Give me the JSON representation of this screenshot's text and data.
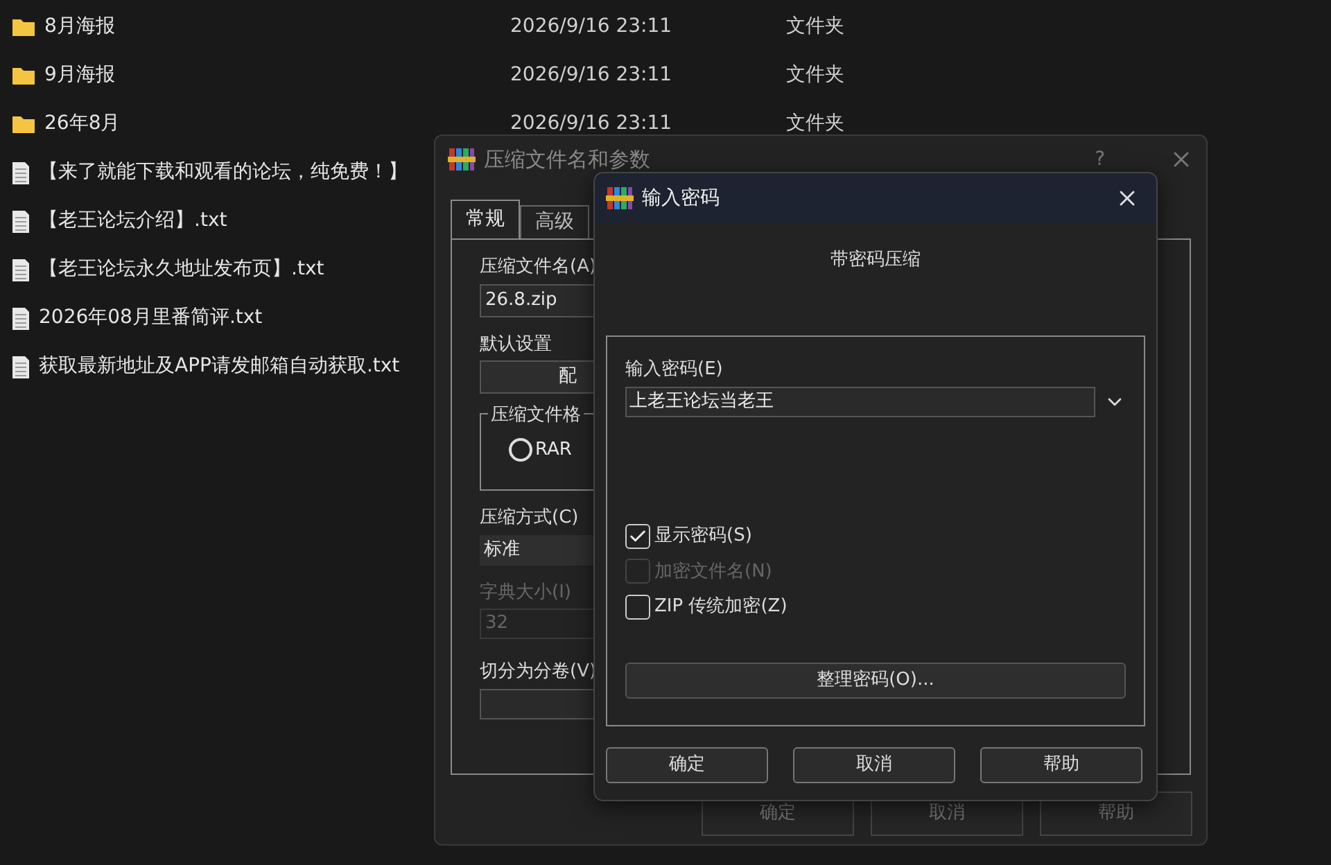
{
  "explorer": {
    "rows": [
      {
        "kind": "folder",
        "name": "8月海报",
        "date": "2026/9/16 23:11",
        "type": "文件夹"
      },
      {
        "kind": "folder",
        "name": "9月海报",
        "date": "2026/9/16 23:11",
        "type": "文件夹"
      },
      {
        "kind": "folder",
        "name": "26年8月",
        "date": "2026/9/16 23:11",
        "type": "文件夹"
      },
      {
        "kind": "file",
        "name": "【来了就能下载和观看的论坛，纯免费！】"
      },
      {
        "kind": "file",
        "name": "【老王论坛介绍】.txt"
      },
      {
        "kind": "file",
        "name": "【老王论坛永久地址发布页】.txt"
      },
      {
        "kind": "file",
        "name": "2026年08月里番简评.txt"
      },
      {
        "kind": "file",
        "name": "获取最新地址及APP请发邮箱自动获取.txt"
      }
    ]
  },
  "back_dialog": {
    "title": "压缩文件名和参数",
    "help": "?",
    "tabs": [
      {
        "label": "常规",
        "selected": true
      },
      {
        "label": "高级",
        "selected": false
      }
    ],
    "archive_name": {
      "label": "压缩文件名(A)",
      "value": "26.8.zip"
    },
    "defaults": {
      "label": "默认设置",
      "button": "配"
    },
    "format": {
      "label": "压缩文件格",
      "options": [
        {
          "label": "RAR",
          "selected": false
        }
      ]
    },
    "method": {
      "label": "压缩方式(C)",
      "value": "标准"
    },
    "dictionary": {
      "label": "字典大小(I)",
      "value": "32",
      "disabled": true
    },
    "split": {
      "label": "切分为分卷(V)"
    },
    "buttons": [
      {
        "label": "确定",
        "disabled": true
      },
      {
        "label": "取消",
        "disabled": true
      },
      {
        "label": "帮助",
        "disabled": true
      }
    ]
  },
  "front_dialog": {
    "title": "输入密码",
    "heading": "带密码压缩",
    "password": {
      "label": "输入密码(E)",
      "value": "上老王论坛当老王"
    },
    "options": [
      {
        "label": "显示密码(S)",
        "checked": true,
        "disabled": false
      },
      {
        "label": "加密文件名(N)",
        "checked": false,
        "disabled": true
      },
      {
        "label": "ZIP 传统加密(Z)",
        "checked": false,
        "disabled": false
      }
    ],
    "manage_button": "整理密码(O)...",
    "buttons": [
      "确定",
      "取消",
      "帮助"
    ]
  }
}
